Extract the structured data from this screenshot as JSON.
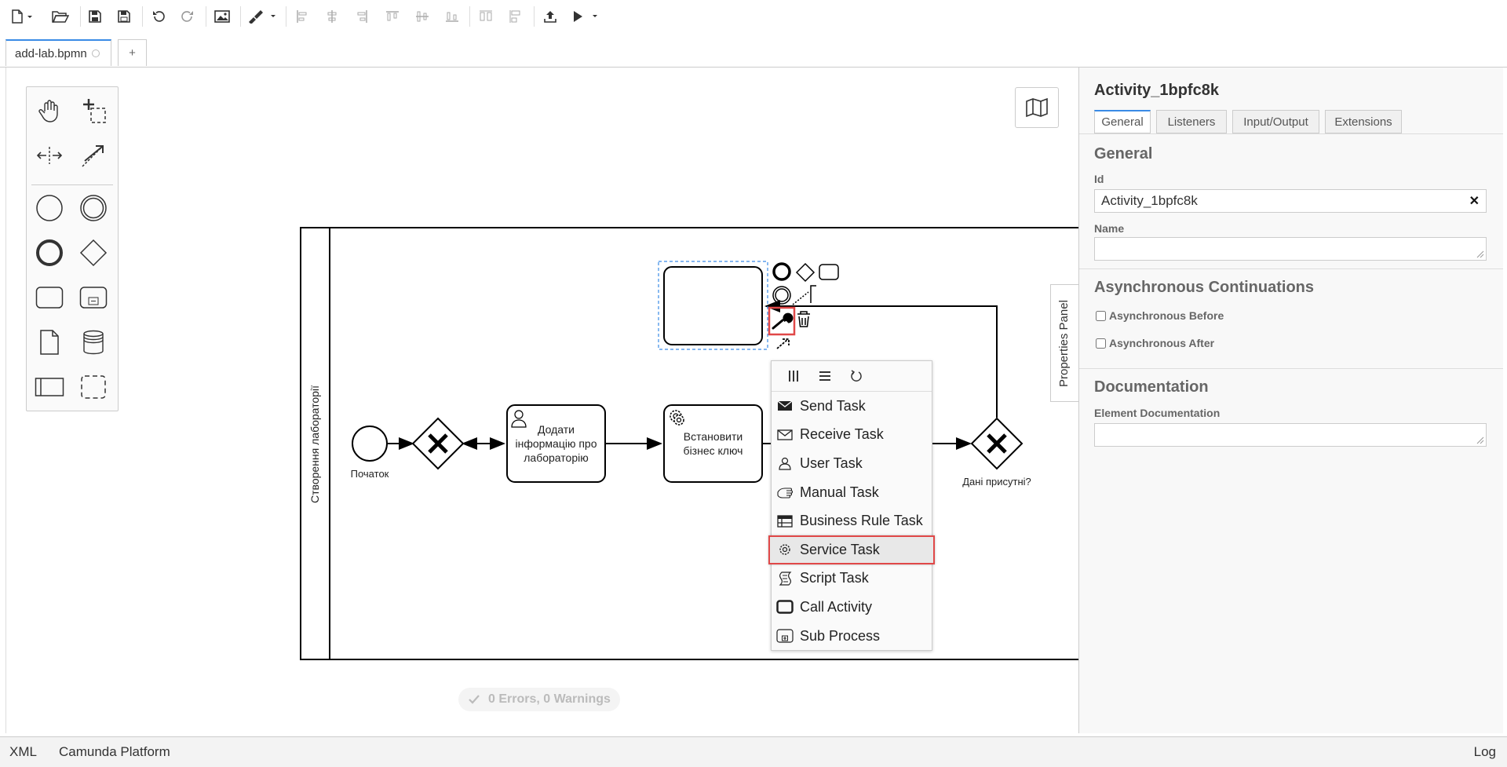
{
  "toolbar": {
    "icons": [
      "new-file-icon",
      "open-folder-icon",
      "save-icon",
      "save-as-icon",
      "undo-icon",
      "redo-icon",
      "export-image-icon",
      "color-brush-icon",
      "align-left-icon",
      "align-center-icon",
      "align-right-icon",
      "align-top-icon",
      "align-middle-icon",
      "align-bottom-icon",
      "distribute-horizontal-icon",
      "distribute-vertical-icon",
      "deploy-icon",
      "run-icon"
    ]
  },
  "tabs": [
    {
      "label": "add-lab.bpmn",
      "active": true
    },
    {
      "label": "+",
      "active": false
    }
  ],
  "diagram": {
    "lane_label": "Створення лабораторії",
    "start_event_label": "Початок",
    "task_add_info": "Додати інформацію про лабораторію",
    "task_set_key": "Встановити бізнес ключ",
    "gateway_label": "Дані присутні?"
  },
  "replace_menu": {
    "items": [
      {
        "label": "Send Task",
        "icon": "send-task-icon"
      },
      {
        "label": "Receive Task",
        "icon": "receive-task-icon"
      },
      {
        "label": "User Task",
        "icon": "user-task-icon"
      },
      {
        "label": "Manual Task",
        "icon": "manual-task-icon"
      },
      {
        "label": "Business Rule Task",
        "icon": "business-rule-task-icon"
      },
      {
        "label": "Service Task",
        "icon": "service-task-icon",
        "highlighted": true
      },
      {
        "label": "Script Task",
        "icon": "script-task-icon"
      },
      {
        "label": "Call Activity",
        "icon": "call-activity-icon"
      },
      {
        "label": "Sub Process",
        "icon": "sub-process-icon"
      }
    ]
  },
  "status": {
    "lint": "0 Errors, 0 Warnings"
  },
  "properties": {
    "toggle_label": "Properties Panel",
    "title": "Activity_1bpfc8k",
    "tabs": [
      "General",
      "Listeners",
      "Input/Output",
      "Extensions"
    ],
    "general_heading": "General",
    "id_label": "Id",
    "id_value": "Activity_1bpfc8k",
    "name_label": "Name",
    "name_value": "",
    "async_heading": "Asynchronous Continuations",
    "async_before": "Asynchronous Before",
    "async_after": "Asynchronous After",
    "doc_heading": "Documentation",
    "doc_label": "Element Documentation",
    "doc_value": ""
  },
  "statusbar": {
    "xml": "XML",
    "platform": "Camunda Platform",
    "log": "Log"
  },
  "colors": {
    "accent": "#3a8be6",
    "highlight": "#e04848"
  }
}
